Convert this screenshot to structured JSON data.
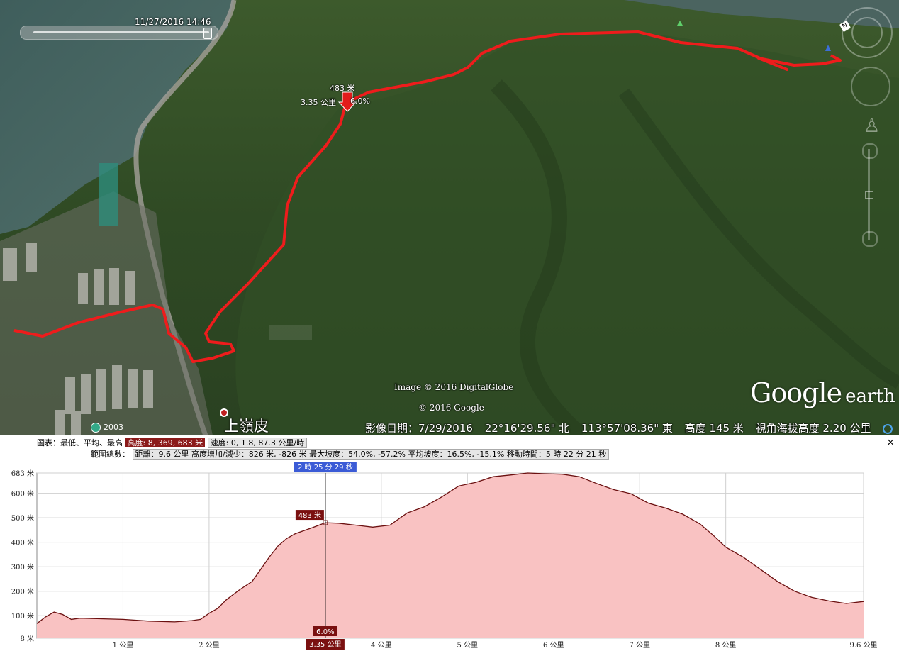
{
  "time_slider": {
    "datetime": "11/27/2016  14:46"
  },
  "map": {
    "cursor_label": {
      "altitude": "483 米",
      "distance": "3.35 公里",
      "slope": "6.0%"
    },
    "place_name": "上嶺皮",
    "year_badge": "2003",
    "imagery_credit": "Image © 2016 DigitalGlobe",
    "google_credit": "© 2016 Google",
    "logo": {
      "google": "Google",
      "earth": "earth"
    }
  },
  "status_bar": {
    "imagery_date": "影像日期：7/29/2016",
    "lat": "22°16'29.56\" 北",
    "lon": "113°57'08.36\" 東",
    "elevation": "高度   145 米",
    "eye_alt": "視角海拔高度   2.20 公里"
  },
  "elevation_profile": {
    "stats_row1": {
      "prefix": "圖表：最低、平均、最高",
      "elevation": "高度: 8, 369, 683 米",
      "speed": "速度: 0, 1.8, 87.3 公里/時"
    },
    "stats_row2": {
      "prefix": "範圍總數：",
      "values": "距離：9.6 公里 高度增加/減少：826 米, -826 米   最大坡度：54.0%, -57.2%   平均坡度：16.5%, -15.1%   移動時間：5 時 22 分 21 秒"
    },
    "cursor": {
      "time": "2 時 25 分 29 秒",
      "alt": "483 米",
      "slope": "6.0%",
      "dist": "3.35 公里"
    },
    "close_label": "×"
  },
  "chart_data": {
    "type": "area",
    "title": "",
    "xlabel": "",
    "ylabel": "",
    "xlim": [
      0,
      9.6
    ],
    "ylim": [
      8,
      683
    ],
    "x_ticks": [
      1,
      2,
      3.35,
      4,
      5,
      6,
      7,
      8,
      9.6
    ],
    "x_tick_labels": [
      "1 公里",
      "2 公里",
      "3.35 公里",
      "4 公里",
      "5 公里",
      "6 公里",
      "7 公里",
      "8 公里",
      "9.6 公里"
    ],
    "y_ticks": [
      8,
      100,
      200,
      300,
      400,
      500,
      600,
      683
    ],
    "y_tick_labels": [
      "8 米",
      "100 米",
      "200 米",
      "300 米",
      "400 米",
      "500 米",
      "600 米",
      "683 米"
    ],
    "cursor_x": 3.35,
    "grid": true,
    "fill_color": "#f9c2c2",
    "line_color": "#6b1010",
    "series": [
      {
        "x": [
          0,
          0.1,
          0.2,
          0.3,
          0.4,
          0.5,
          0.7,
          1.0,
          1.3,
          1.6,
          1.8,
          1.9,
          2.0,
          2.1,
          2.2,
          2.35,
          2.5,
          2.6,
          2.7,
          2.8,
          2.9,
          3.0,
          3.2,
          3.35,
          3.5,
          3.7,
          3.9,
          4.1,
          4.3,
          4.5,
          4.7,
          4.9,
          5.1,
          5.3,
          5.5,
          5.7,
          5.9,
          6.1,
          6.3,
          6.5,
          6.7,
          6.9,
          7.1,
          7.3,
          7.5,
          7.7,
          7.85,
          8.0,
          8.2,
          8.4,
          8.6,
          8.8,
          9.0,
          9.2,
          9.4,
          9.6
        ],
        "y": [
          68,
          95,
          115,
          105,
          85,
          90,
          88,
          85,
          78,
          75,
          80,
          85,
          110,
          130,
          165,
          205,
          240,
          290,
          340,
          385,
          415,
          435,
          460,
          480,
          478,
          470,
          462,
          470,
          520,
          545,
          585,
          630,
          645,
          668,
          675,
          683,
          680,
          678,
          668,
          640,
          615,
          598,
          560,
          540,
          515,
          475,
          430,
          380,
          340,
          290,
          240,
          200,
          175,
          160,
          150,
          158
        ]
      }
    ]
  }
}
